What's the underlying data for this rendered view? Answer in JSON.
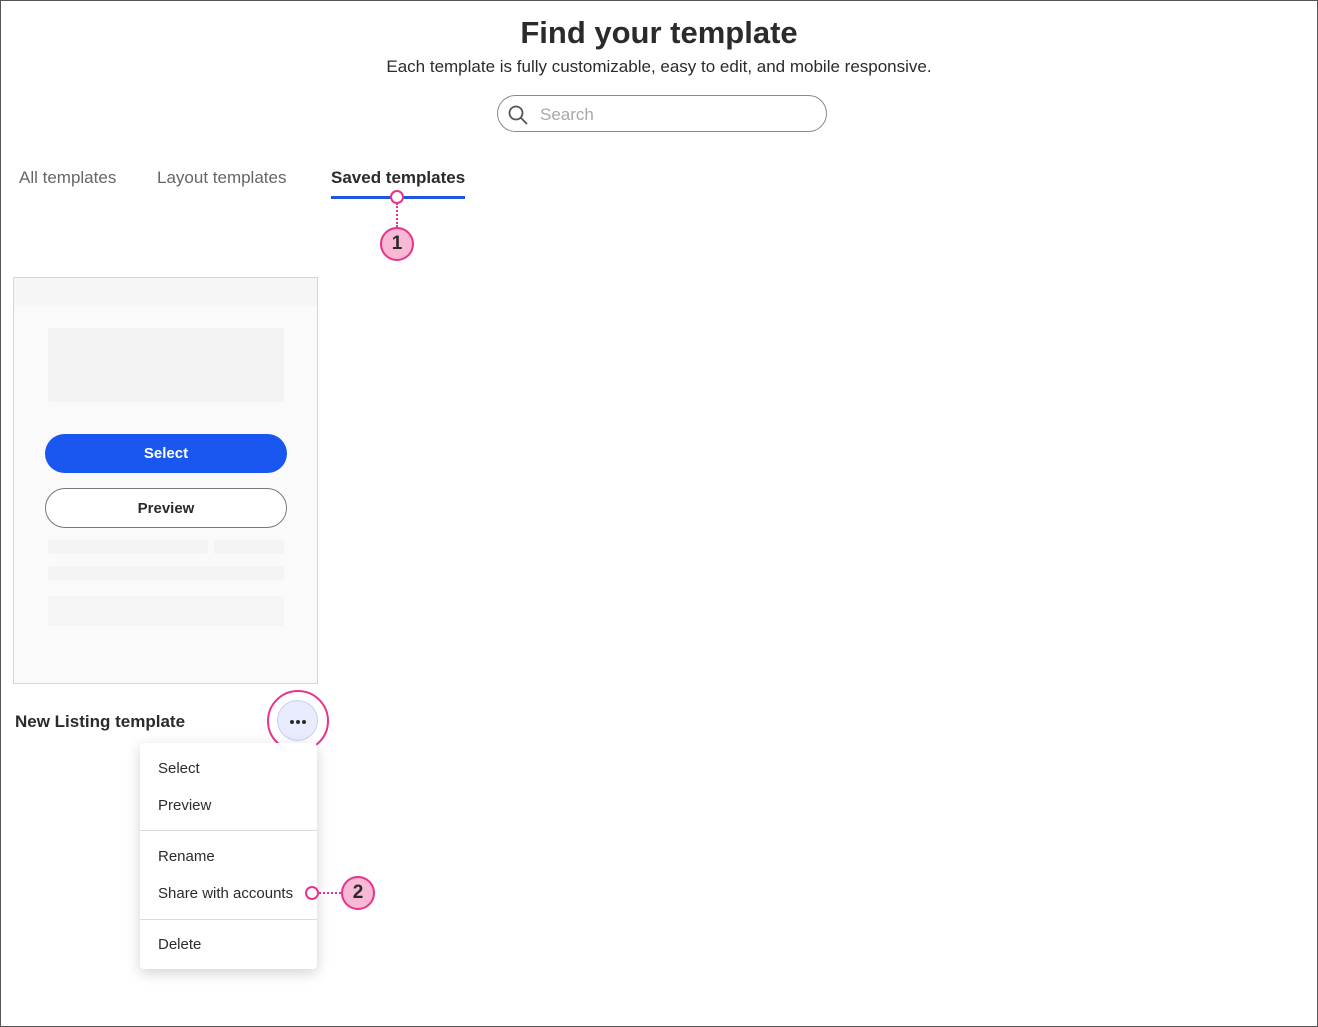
{
  "header": {
    "title": "Find your template",
    "subtitle": "Each template is fully customizable, easy to edit, and mobile responsive."
  },
  "search": {
    "placeholder": "Search",
    "value": "",
    "icon": "search-icon"
  },
  "tabs": [
    {
      "label": "All templates",
      "active": false
    },
    {
      "label": "Layout templates",
      "active": false
    },
    {
      "label": "Saved templates",
      "active": true
    }
  ],
  "colors": {
    "accent": "#1a56f0",
    "tab_underline": "#1f56e0",
    "callout_fill": "#f9b8d4",
    "callout_border": "#e8338b",
    "more_button_bg": "#e8ecfd"
  },
  "template_card": {
    "name": "New Listing template",
    "select_label": "Select",
    "preview_label": "Preview",
    "more_icon": "ellipsis-icon"
  },
  "context_menu": {
    "items": [
      {
        "label": "Select"
      },
      {
        "label": "Preview"
      },
      {
        "label": "Rename"
      },
      {
        "label": "Share with accounts"
      },
      {
        "label": "Delete"
      }
    ]
  },
  "callouts": [
    {
      "number": "1"
    },
    {
      "number": "2"
    }
  ]
}
